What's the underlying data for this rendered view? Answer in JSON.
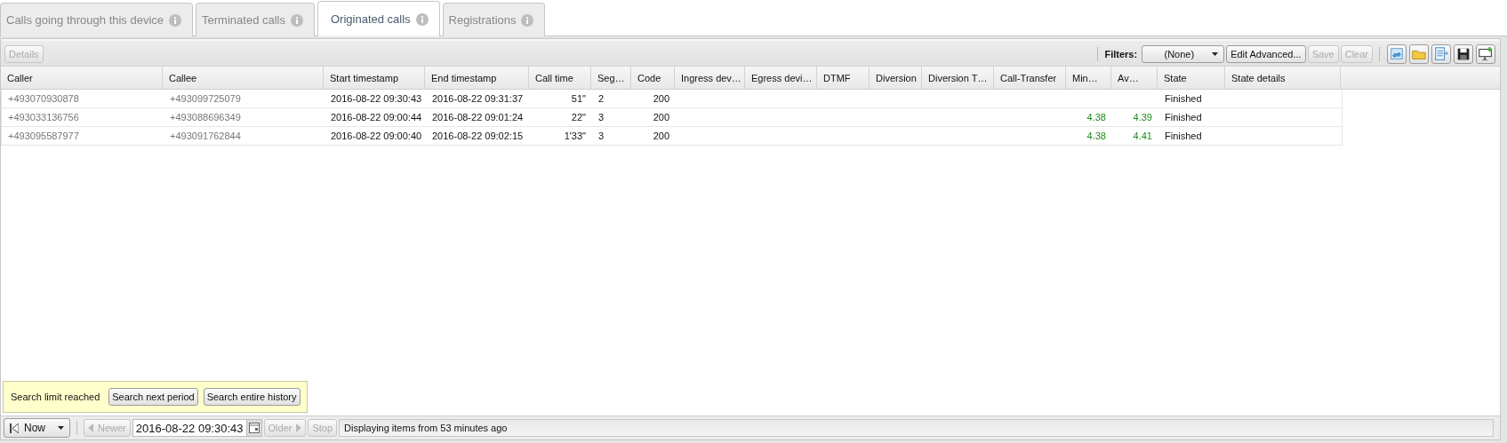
{
  "tabs": [
    {
      "label": "Calls going through this device",
      "selected": false
    },
    {
      "label": "Terminated calls",
      "selected": false
    },
    {
      "label": "Originated calls",
      "selected": true
    },
    {
      "label": "Registrations",
      "selected": false
    }
  ],
  "toolbar": {
    "details_button": {
      "label": "Details",
      "disabled": true
    },
    "filters_label": "Filters:",
    "filter_select": "(None)",
    "edit_button": {
      "label": "Edit Advanced...",
      "disabled": false
    },
    "save_button": {
      "label": "Save",
      "disabled": true
    },
    "clear_button": {
      "label": "Clear",
      "disabled": true
    }
  },
  "table": {
    "columns": [
      {
        "label": "Caller",
        "kind": "phone"
      },
      {
        "label": "Callee",
        "kind": "phone"
      },
      {
        "label": "Start timestamp",
        "kind": "text"
      },
      {
        "label": "End timestamp",
        "kind": "text"
      },
      {
        "label": "Call time",
        "kind": "amount"
      },
      {
        "label": "Seg…",
        "kind": "text"
      },
      {
        "label": "Code",
        "kind": "amount"
      },
      {
        "label": "Ingress dev…",
        "kind": "text"
      },
      {
        "label": "Egress devi…",
        "kind": "text"
      },
      {
        "label": "DTMF",
        "kind": "text"
      },
      {
        "label": "Diversion",
        "kind": "text"
      },
      {
        "label": "Diversion T…",
        "kind": "text"
      },
      {
        "label": "Call-Transfer",
        "kind": "text"
      },
      {
        "label": "Min…",
        "kind": "quality"
      },
      {
        "label": "Av…",
        "kind": "quality"
      },
      {
        "label": "State",
        "kind": "text"
      },
      {
        "label": "State details",
        "kind": "text"
      }
    ],
    "rows": [
      {
        "cells": [
          "+493070930878",
          "+493099725079",
          "2016-08-22 09:30:43",
          "2016-08-22 09:31:37",
          "51\"",
          "2",
          "200",
          null,
          null,
          null,
          null,
          null,
          null,
          null,
          null,
          "Finished",
          null
        ]
      },
      {
        "cells": [
          "+493033136756",
          "+493088696349",
          "2016-08-22 09:00:44",
          "2016-08-22 09:01:24",
          "22\"",
          "3",
          "200",
          null,
          null,
          null,
          null,
          null,
          null,
          "4.38",
          "4.39",
          "Finished",
          null
        ]
      },
      {
        "cells": [
          "+493095587977",
          "+493091762844",
          "2016-08-22 09:00:40",
          "2016-08-22 09:02:15",
          "1'33\"",
          "3",
          "200",
          null,
          null,
          null,
          null,
          null,
          null,
          "4.38",
          "4.41",
          "Finished",
          null
        ]
      }
    ]
  },
  "notice": {
    "text": "Search limit reached",
    "buttons": [
      "Search next period",
      "Search entire history"
    ]
  },
  "status_bar": {
    "now_button": "Now",
    "newer_button": {
      "label": "Newer",
      "disabled": true
    },
    "date_field": "2016-08-22 09:30:43",
    "older_button": {
      "label": "Older",
      "disabled": true
    },
    "stop_button": {
      "label": "Stop",
      "disabled": true
    },
    "message": "Displaying items from 53 minutes ago"
  }
}
